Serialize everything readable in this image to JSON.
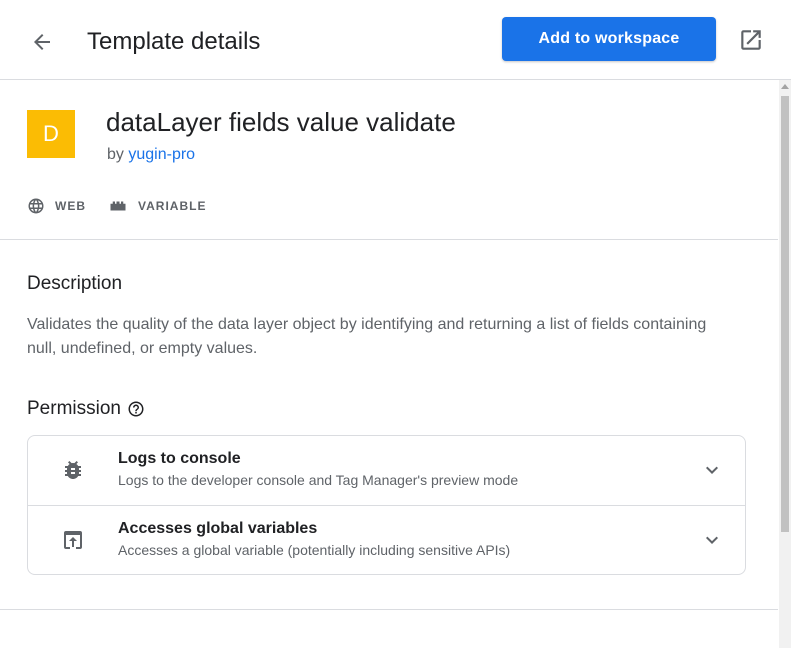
{
  "header": {
    "title": "Template details",
    "primary_action": "Add to workspace"
  },
  "template": {
    "logo_letter": "D",
    "name": "dataLayer fields value validate",
    "by_prefix": "by",
    "author": "yugin-pro",
    "tags": [
      {
        "label": "WEB",
        "icon": "globe-icon"
      },
      {
        "label": "VARIABLE",
        "icon": "variable-icon"
      }
    ]
  },
  "description": {
    "heading": "Description",
    "text": "Validates the quality of the data layer object by identifying and returning a list of fields containing null, undefined, or empty values."
  },
  "permission": {
    "heading": "Permission",
    "items": [
      {
        "title": "Logs to console",
        "subtitle": "Logs to the developer console and Tag Manager's preview mode",
        "icon": "bug-icon"
      },
      {
        "title": "Accesses global variables",
        "subtitle": "Accesses a global variable (potentially including sensitive APIs)",
        "icon": "upload-box-icon"
      }
    ]
  },
  "colors": {
    "accent": "#1a73e8",
    "logo_bg": "#fbbc04",
    "text_primary": "#202124",
    "text_secondary": "#5f6368",
    "divider": "#dadce0"
  }
}
